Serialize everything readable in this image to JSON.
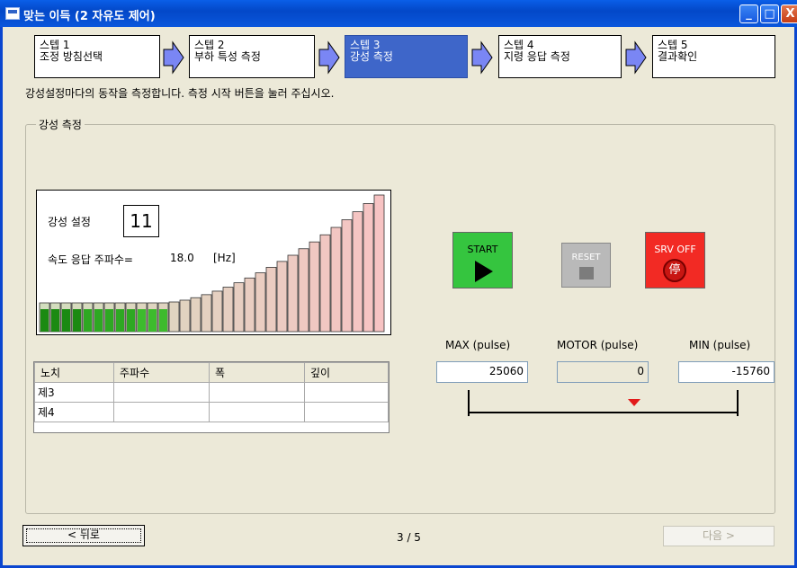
{
  "window": {
    "title": "맞는 이득 (2 자유도 제어)",
    "buttons": {
      "minimize": "_",
      "maximize": "□",
      "close": "X"
    }
  },
  "steps": [
    {
      "line1": "스텝 1",
      "line2": "조정 방침선택",
      "active": false
    },
    {
      "line1": "스텝 2",
      "line2": "부하 특성 측정",
      "active": false
    },
    {
      "line1": "스텝 3",
      "line2": "강성 측정",
      "active": true
    },
    {
      "line1": "스텝 4",
      "line2": "지령 응답 측정",
      "active": false
    },
    {
      "line1": "스텝 5",
      "line2": "결과확인",
      "active": false
    }
  ],
  "instruction": "강성설정마다의 동작을 측정합니다. 측정 시작 버튼을 눌러 주십시오.",
  "group_label": "강성 측정",
  "gauge": {
    "stiffness_label": "강성 설정",
    "stiffness_value": "11",
    "speed_label": "속도 응답 주파수=",
    "speed_value": "18.0",
    "speed_unit": "[Hz]",
    "active_bars": 12,
    "total_bars": 32
  },
  "notch_table": {
    "headers": [
      "노치",
      "주파수",
      "폭",
      "깊이"
    ],
    "rows": [
      [
        "제3",
        "",
        "",
        ""
      ],
      [
        "제4",
        "",
        "",
        ""
      ]
    ]
  },
  "controls": {
    "start_label": "START",
    "reset_label": "RESET",
    "srv_off_label": "SRV OFF",
    "srv_off_symbol": "停"
  },
  "pulse": {
    "max_label": "MAX (pulse)",
    "motor_label": "MOTOR (pulse)",
    "min_label": "MIN (pulse)",
    "max_value": "25060",
    "motor_value": "0",
    "min_value": "-15760"
  },
  "footer": {
    "back_label": "< 뒤로",
    "page_indicator": "3 / 5",
    "next_label": "다음 >"
  },
  "colors": {
    "title_bar": "#0348c8",
    "active_step": "#3e66c9",
    "step_arrow": "#7a86f4",
    "bar_active": "#26a51d",
    "bar_peak": "#f7c3c3",
    "start": "#35c53f",
    "srv_off": "#f22a24",
    "marker": "#e21a1a"
  }
}
